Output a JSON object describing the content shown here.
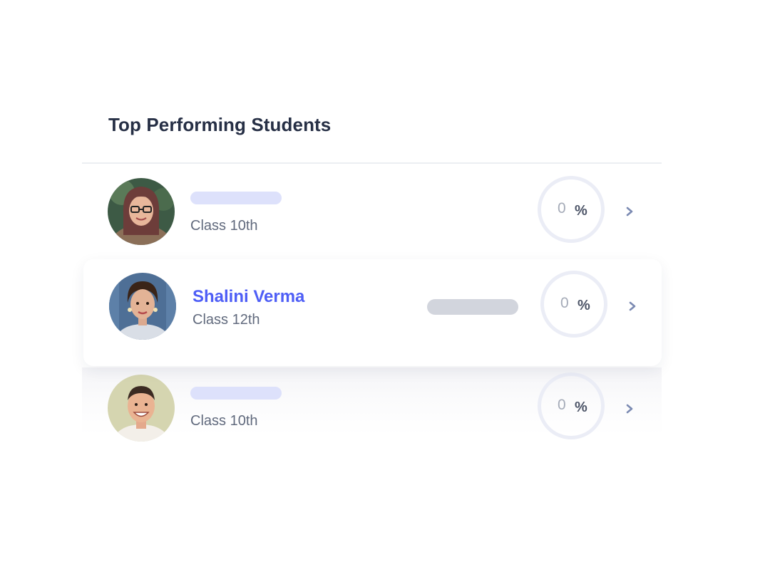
{
  "widget": {
    "title": "Top Performing Students"
  },
  "students": [
    {
      "name": "",
      "class_label": "Class 10th",
      "percent_value": "0",
      "percent_sign": "%",
      "avatar_icon": "student-photo-woman-glasses"
    },
    {
      "name": "Shalini Verma",
      "class_label": "Class 12th",
      "percent_value": "0",
      "percent_sign": "%",
      "avatar_icon": "student-photo-woman-earrings"
    },
    {
      "name": "",
      "class_label": "Class 10th",
      "percent_value": "0",
      "percent_sign": "%",
      "avatar_icon": "student-photo-man-smiling"
    }
  ],
  "colors": {
    "title": "#262f45",
    "accent_name": "#4e5ef6",
    "placeholder_name": "#dde1fb",
    "placeholder_bar": "#d2d5dd",
    "ring": "#ebedf6",
    "chevron": "#7b8ab2"
  }
}
